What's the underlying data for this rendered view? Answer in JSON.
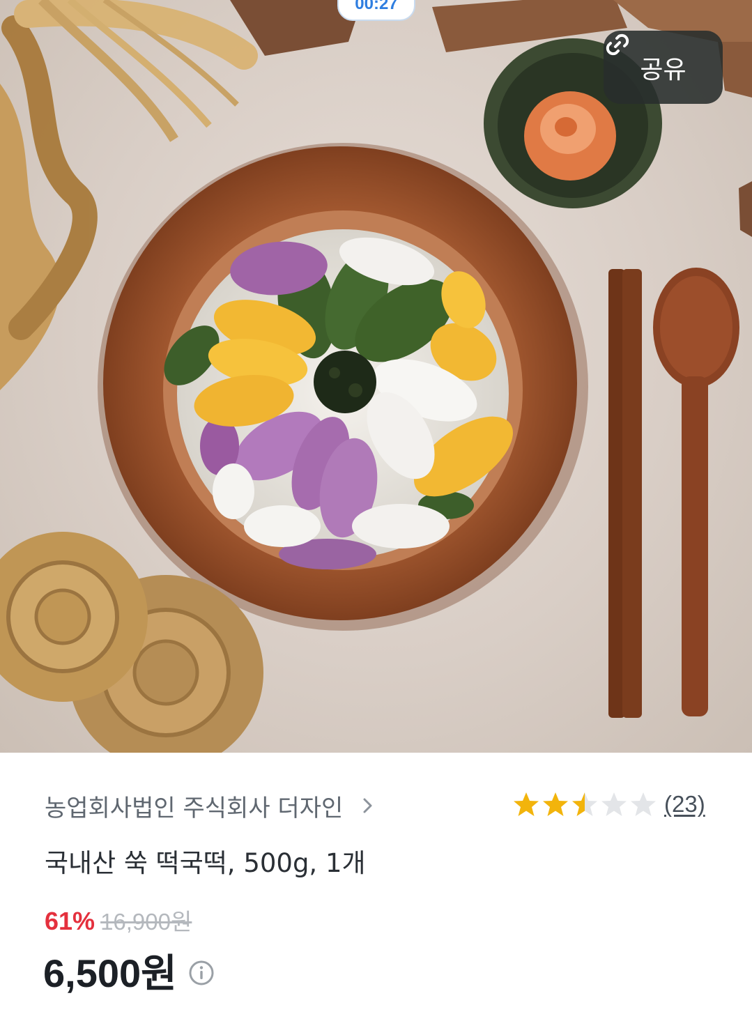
{
  "status": {
    "timer": "00:27"
  },
  "hero": {
    "image_alt": "Colorful tteokguk rice cake slices in a wooden bowl",
    "share_label": "공유"
  },
  "product": {
    "seller": "농업회사법인 주식회사 더자인",
    "rating": {
      "value": 2.5,
      "max": 5,
      "count_text": "(23)"
    },
    "title": "국내산 쑥 떡국떡, 500g, 1개",
    "discount_percent": "61%",
    "original_price": "16,900원",
    "sale_price": "6,500원"
  },
  "colors": {
    "discount": "#e4303d",
    "star_filled": "#f2b40c",
    "star_empty": "#e3e5e8",
    "timer": "#2f7ee0"
  }
}
